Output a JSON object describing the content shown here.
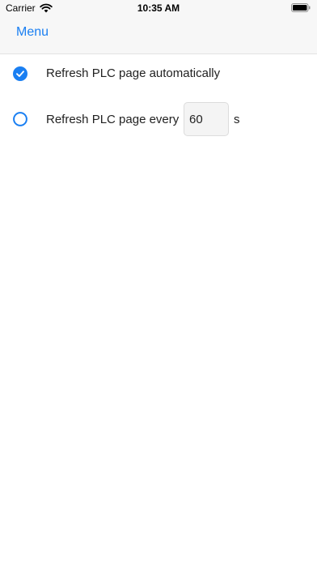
{
  "status_bar": {
    "carrier": "Carrier",
    "time": "10:35 AM"
  },
  "nav": {
    "back_label": "Menu"
  },
  "settings": {
    "auto_refresh": {
      "label": "Refresh PLC page automatically",
      "selected": true
    },
    "interval_refresh": {
      "label": "Refresh PLC page every",
      "value": "60",
      "unit": "s",
      "selected": false
    }
  },
  "colors": {
    "accent": "#1a7ff2",
    "header_bg": "#f7f7f7"
  }
}
